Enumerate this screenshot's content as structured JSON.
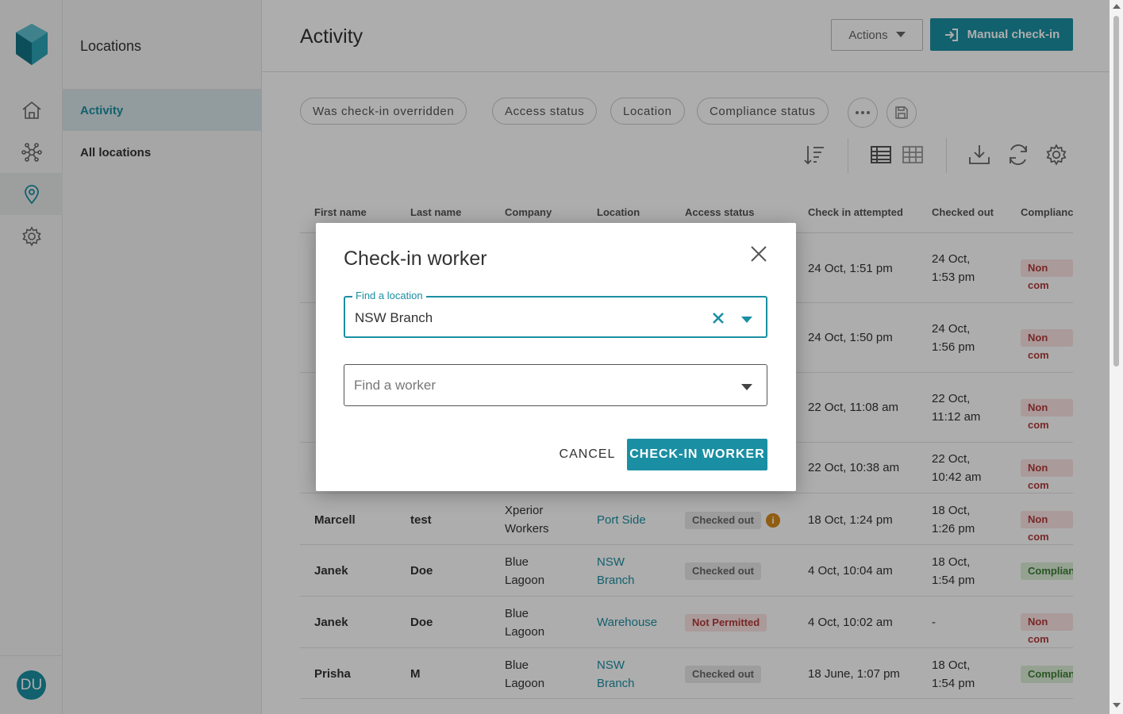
{
  "sidebar": {
    "title": "Locations",
    "items": [
      {
        "label": "Activity"
      },
      {
        "label": "All locations"
      }
    ],
    "avatar_initials": "DU"
  },
  "rail_icons": [
    "home-icon",
    "network-icon",
    "location-pin-icon",
    "gear-icon"
  ],
  "header": {
    "title": "Activity",
    "actions_label": "Actions",
    "manual_checkin_label": "Manual check-in"
  },
  "filters": [
    "Was check-in overridden",
    "Access status",
    "Location",
    "Compliance status"
  ],
  "table": {
    "columns": [
      "First name",
      "Last name",
      "Company",
      "Location",
      "Access status",
      "Check in attempted",
      "Checked out",
      "Complianc"
    ],
    "rows": [
      {
        "first": "",
        "last": "",
        "company1": "",
        "company2": "",
        "loc1": "",
        "loc2": "",
        "access": "",
        "checkin": "24 Oct, 1:51 pm",
        "out1": "24 Oct,",
        "out2": "1:53 pm",
        "compliance": "Non com"
      },
      {
        "first": "",
        "last": "",
        "company1": "",
        "company2": "",
        "loc1": "",
        "loc2": "",
        "access": "",
        "checkin": "24 Oct, 1:50 pm",
        "out1": "24 Oct,",
        "out2": "1:56 pm",
        "compliance": "Non com"
      },
      {
        "first": "",
        "last": "",
        "company1": "",
        "company2": "",
        "loc1": "",
        "loc2": "",
        "access": "",
        "checkin": "22 Oct, 11:08 am",
        "out1": "22 Oct,",
        "out2": "11:12 am",
        "compliance": "Non com"
      },
      {
        "first": "",
        "last": "",
        "company1": "",
        "company2": "",
        "loc1": "",
        "loc2": "",
        "access": "",
        "checkin": "22 Oct, 10:38 am",
        "out1": "22 Oct,",
        "out2": "10:42 am",
        "compliance": "Non com"
      },
      {
        "first": "Marcell",
        "last": "test",
        "company1": "Xperior",
        "company2": "Workers",
        "loc1": "Port Side",
        "loc2": "",
        "access": "Checked out",
        "checkin": "18 Oct, 1:24 pm",
        "out1": "18 Oct,",
        "out2": "1:26 pm",
        "compliance": "Non com"
      },
      {
        "first": "Janek",
        "last": "Doe",
        "company1": "Blue",
        "company2": "Lagoon",
        "loc1": "NSW",
        "loc2": "Branch",
        "access": "Checked out",
        "checkin": "4 Oct, 10:04 am",
        "out1": "18 Oct,",
        "out2": "1:54 pm",
        "compliance": "Complian"
      },
      {
        "first": "Janek",
        "last": "Doe",
        "company1": "Blue",
        "company2": "Lagoon",
        "loc1": "Warehouse",
        "loc2": "",
        "access": "Not Permitted",
        "checkin": "4 Oct, 10:02 am",
        "out1": "-",
        "out2": "",
        "compliance": "Non com"
      },
      {
        "first": "Prisha",
        "last": "M",
        "company1": "Blue",
        "company2": "Lagoon",
        "loc1": "NSW",
        "loc2": "Branch",
        "access": "Checked out",
        "checkin": "18 June, 1:07 pm",
        "out1": "18 Oct,",
        "out2": "1:54 pm",
        "compliance": "Complian"
      }
    ]
  },
  "modal": {
    "title": "Check-in worker",
    "location_label": "Find a location",
    "location_value": "NSW Branch",
    "worker_placeholder": "Find a worker",
    "cancel_label": "CANCEL",
    "submit_label": "CHECK-IN WORKER"
  },
  "colors": {
    "accent": "#1a8fa3",
    "non_compliant": "#b33a3a",
    "compliant": "#3f7d35",
    "warning": "#d68a1a"
  }
}
